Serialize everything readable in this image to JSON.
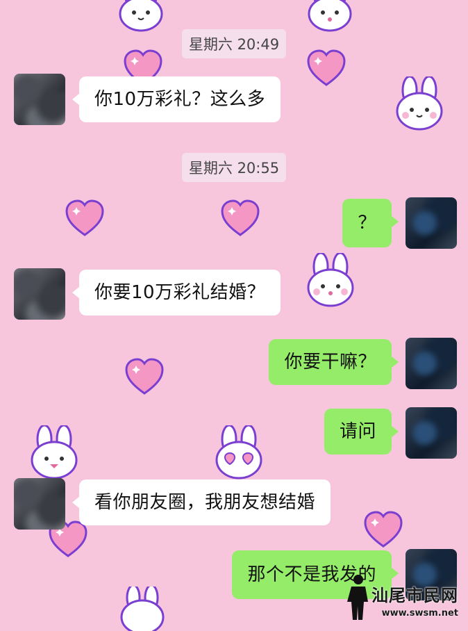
{
  "chat": {
    "timestamps": [
      "星期六 20:49",
      "星期六 20:55"
    ],
    "messages": [
      {
        "side": "in",
        "text": "你10万彩礼？这么多"
      },
      {
        "side": "out",
        "text": "？"
      },
      {
        "side": "in",
        "text": "你要10万彩礼结婚？"
      },
      {
        "side": "out",
        "text": "你要干嘛？"
      },
      {
        "side": "out",
        "text": "请问"
      },
      {
        "side": "in",
        "text": "看你朋友圈，我朋友想结婚"
      },
      {
        "side": "out",
        "text": "那个不是我发的"
      }
    ]
  },
  "watermark": {
    "main": "汕尾市民网",
    "url": "www.swsm.net"
  },
  "colors": {
    "background": "#f7c6dd",
    "incoming_bubble": "#ffffff",
    "outgoing_bubble": "#95ec69"
  }
}
